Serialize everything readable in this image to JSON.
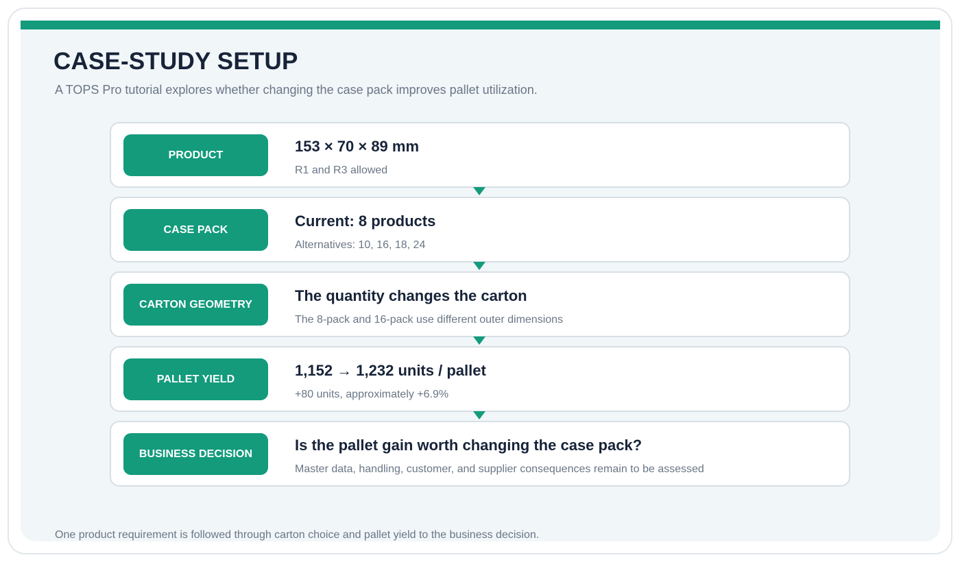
{
  "header": {
    "title": "CASE-STUDY SETUP",
    "subtitle": "A TOPS Pro tutorial explores whether changing the case pack improves pallet utilization."
  },
  "steps": [
    {
      "badge": "PRODUCT",
      "heading": "153 × 70 × 89 mm",
      "detail": "R1 and R3 allowed"
    },
    {
      "badge": "CASE PACK",
      "heading": "Current: 8 products",
      "detail": "Alternatives: 10, 16, 18, 24"
    },
    {
      "badge": "CARTON GEOMETRY",
      "heading": "The quantity changes the carton",
      "detail": "The 8-pack and 16-pack use different outer dimensions"
    },
    {
      "badge": "PALLET YIELD",
      "heading": "1,152 → 1,232 units / pallet",
      "detail": "+80 units, approximately +6.9%"
    },
    {
      "badge": "BUSINESS DECISION",
      "heading": "Is the pallet gain worth changing the case pack?",
      "detail": "Master data, handling, customer, and supplier consequences remain to be assessed"
    }
  ],
  "footer": {
    "note": "One product requirement is followed through carton choice and pallet yield to the business decision."
  },
  "colors": {
    "accent": "#139b7c",
    "heading_text": "#172338",
    "muted_text": "#6a7686",
    "panel_background": "#f1f6f9",
    "card_border": "#d7dfe5"
  },
  "icons": {
    "connector": "down-triangle-arrow-icon"
  }
}
